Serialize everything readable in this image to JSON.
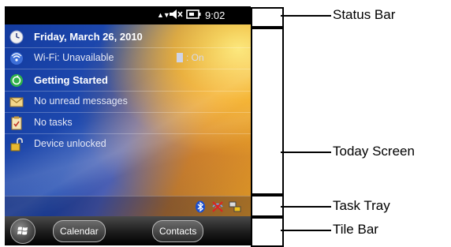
{
  "status_bar": {
    "time": "9:02",
    "signal_glyph": "▲▼",
    "volume_glyph": "speaker-muted-icon",
    "battery_glyph": "battery-plug-icon"
  },
  "today_items": [
    {
      "label": "Friday, March 26, 2010",
      "icon": "clock-icon"
    },
    {
      "label": "Wi-Fi: Unavailable",
      "icon": "wifi-icon",
      "toggle": ": On"
    },
    {
      "label": "Getting Started",
      "icon": "getting-started-icon"
    },
    {
      "label": "No unread messages",
      "icon": "envelope-icon"
    },
    {
      "label": "No tasks",
      "icon": "clipboard-icon"
    },
    {
      "label": "Device unlocked",
      "icon": "padlock-open-icon"
    }
  ],
  "task_tray": {
    "icons": [
      "bluetooth-icon",
      "wlan-off-icon",
      "connectivity-icon"
    ]
  },
  "tile_bar": {
    "calendar": "Calendar",
    "contacts": "Contacts",
    "start": "windows-start-icon"
  },
  "annotations": {
    "status_bar": "Status Bar",
    "today_screen": "Today Screen",
    "task_tray": "Task Tray",
    "tile_bar": "Tile Bar"
  },
  "colors": {
    "status_bar": "#000000",
    "text": "#ffffff",
    "annotation": "#000000"
  }
}
